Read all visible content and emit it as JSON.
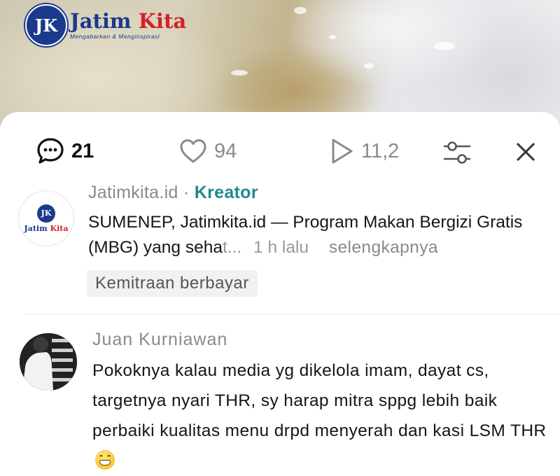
{
  "header_photo": {
    "logo": {
      "initials": "JK",
      "name_main": "Jatim",
      "name_accent": "Kita",
      "tagline": "Mengabarkan & Menginspirasi"
    }
  },
  "toolbar": {
    "comments_count": "21",
    "likes_count": "94",
    "views_count": "11,2",
    "filter_icon": "sliders-icon",
    "close_icon": "close-icon"
  },
  "post": {
    "author": "Jatimkita.id",
    "separator": " · ",
    "role": "Kreator",
    "text_visible": "SUMENEP, Jatimkita.id — Program Makan Bergizi Gratis (MBG) yang seha",
    "text_faded": "t...",
    "time": "1 h lalu",
    "more_label": "selengkapnya",
    "chip_label": "Kemitraan berbayar",
    "avatar_initials": "JK",
    "avatar_name_main": "Jatim",
    "avatar_name_accent": "Kita"
  },
  "comment": {
    "author": "Juan Kurniawan",
    "text": "Pokoknya kalau media yg dikelola imam, dayat cs, targetnya nyari THR, sy harap mitra sppg lebih baik perbaiki kualitas menu drpd menyerah dan kasi LSM THR",
    "emoji": "grinning-face-emoji"
  },
  "colors": {
    "brand_blue": "#1b3a8c",
    "brand_red": "#d32027",
    "creator_teal": "#1f8a8c",
    "muted_text": "#8a8a8a"
  }
}
